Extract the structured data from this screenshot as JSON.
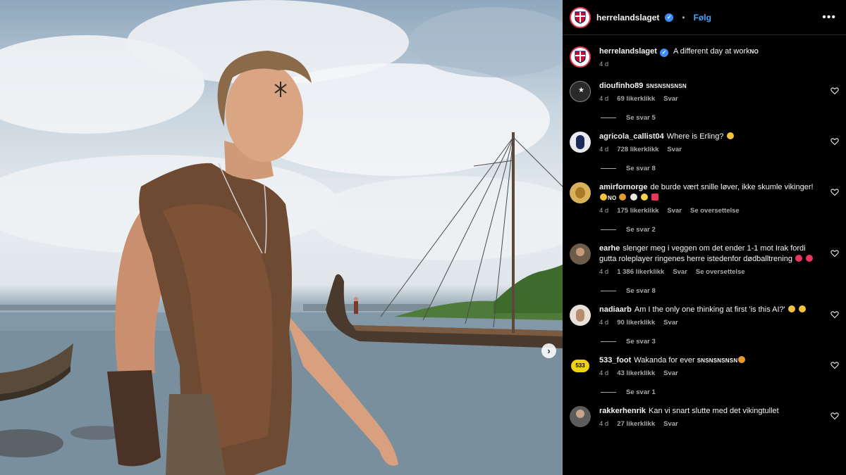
{
  "post": {
    "account": "herrelandslaget",
    "follow_label": "Følg",
    "more_label": "•••",
    "caption": "A different day at work",
    "caption_flag": "NO",
    "caption_time": "4 d"
  },
  "photo": {
    "next_label": "›",
    "description_icon": "viking-ship-photo"
  },
  "comments": [
    {
      "username": "dioufinho89",
      "text": "SNSNSNSNSN",
      "time": "4 d",
      "likes": "69 likerklikk",
      "reply": "Svar",
      "view_replies": "Se svar 5",
      "avatar_color": "#2a2a2a"
    },
    {
      "username": "agricola_callist04",
      "text": "Where is Erling?",
      "time": "4 d",
      "likes": "728 likerklikk",
      "reply": "Svar",
      "view_replies": "Se svar 8",
      "avatar_color": "#e9e9ef"
    },
    {
      "username": "amirfornorge",
      "text": "de burde vært snille løver, ikke skumle vikinger!",
      "text_flag": "NO",
      "time": "4 d",
      "likes": "175 likerklikk",
      "reply": "Svar",
      "translate": "Se oversettelse",
      "view_replies": "Se svar 2",
      "avatar_color": "#d8b25a"
    },
    {
      "username": "earhe",
      "text": "slenger meg i veggen om det ender 1-1 mot Irak fordi gutta roleplayer ringenes herre istedenfor dødballtrening",
      "time": "4 d",
      "likes": "1 386 likerklikk",
      "reply": "Svar",
      "translate": "Se oversettelse",
      "view_replies": "Se svar 8",
      "avatar_color": "#6d5b4c"
    },
    {
      "username": "nadiaarb",
      "text": "Am I the only one thinking at first 'is this AI?'",
      "time": "4 d",
      "likes": "90 likerklikk",
      "reply": "Svar",
      "view_replies": "Se svar 3",
      "avatar_color": "#e8e1da"
    },
    {
      "username": "533_foot",
      "text": "Wakanda for ever",
      "text_suffix": "SNSNSNSNSN",
      "avatar_label": "533",
      "time": "4 d",
      "likes": "43 likerklikk",
      "reply": "Svar",
      "view_replies": "Se svar 1",
      "avatar_color": "#f2d20a"
    },
    {
      "username": "rakkerhenrik",
      "text": "Kan vi snart slutte med det vikingtullet",
      "time": "4 d",
      "likes": "27 likerklikk",
      "reply": "Svar",
      "avatar_color": "#5c5c5c"
    }
  ],
  "colors": {
    "accent": "#4aa3f6",
    "verified": "#3a8ef6",
    "story_ring": "#e03a4e",
    "muted": "#a8a8a8"
  }
}
